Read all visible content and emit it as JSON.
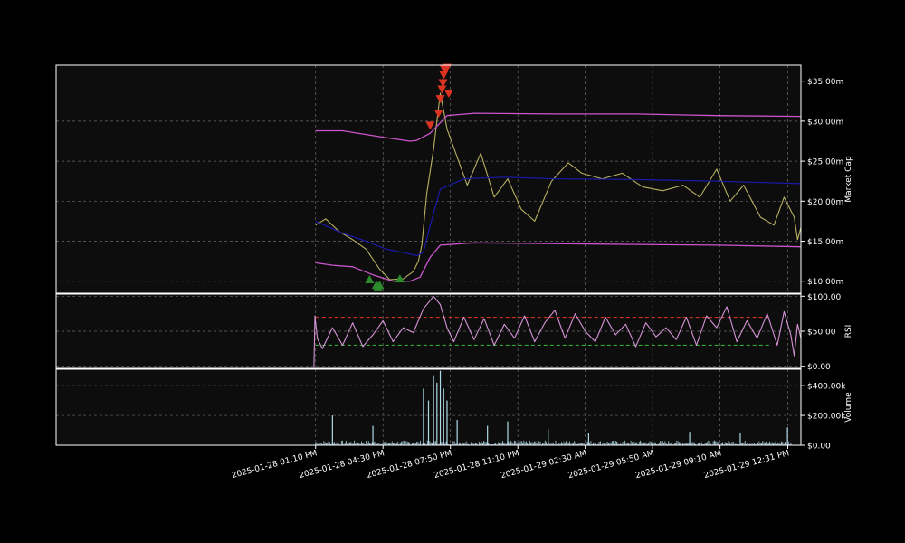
{
  "chart_data": {
    "type": "line",
    "x_range": [
      "2025-01-28 00:20",
      "2025-01-29 13:10"
    ],
    "x_ticks": [
      "2025-01-28 01:10 PM",
      "2025-01-28 04:30 PM",
      "2025-01-28 07:50 PM",
      "2025-01-28 11:10 PM",
      "2025-01-29 02:30 AM",
      "2025-01-29 05:50 AM",
      "2025-01-29 09:10 AM",
      "2025-01-29 12:31 PM"
    ],
    "x_tick_times": [
      "2025-01-28 13:10",
      "2025-01-28 16:30",
      "2025-01-28 19:50",
      "2025-01-28 23:10",
      "2025-01-29 02:30",
      "2025-01-29 05:50",
      "2025-01-29 09:10",
      "2025-01-29 12:31"
    ],
    "grid": true,
    "panels": {
      "price": {
        "ylabel": "Market Cap",
        "ylim": [
          8.5,
          37.0
        ],
        "y_ticks": [
          10,
          15,
          20,
          25,
          30,
          35
        ],
        "y_tick_labels": [
          "$10.00m",
          "$15.00m",
          "$20.00m",
          "$25.00m",
          "$30.00m",
          "$35.00m"
        ],
        "unit": "$ millions",
        "series": [
          {
            "color": "#b8b060",
            "x": [
              "2025-01-28 13:10",
              "2025-01-28 13:40",
              "2025-01-28 14:20",
              "2025-01-28 15:00",
              "2025-01-28 15:40",
              "2025-01-28 16:20",
              "2025-01-28 16:50",
              "2025-01-28 17:30",
              "2025-01-28 18:00",
              "2025-01-28 18:15",
              "2025-01-28 18:25",
              "2025-01-28 18:40",
              "2025-01-28 19:00",
              "2025-01-28 19:20",
              "2025-01-28 19:40",
              "2025-01-28 20:10",
              "2025-01-28 20:40",
              "2025-01-28 21:20",
              "2025-01-28 22:00",
              "2025-01-28 22:40",
              "2025-01-28 23:20",
              "2025-01-29 00:00",
              "2025-01-29 00:50",
              "2025-01-29 01:40",
              "2025-01-29 02:20",
              "2025-01-29 03:20",
              "2025-01-29 04:20",
              "2025-01-29 05:20",
              "2025-01-29 06:20",
              "2025-01-29 07:20",
              "2025-01-29 08:10",
              "2025-01-29 09:00",
              "2025-01-29 09:40",
              "2025-01-29 10:20",
              "2025-01-29 11:10",
              "2025-01-29 11:50",
              "2025-01-29 12:20",
              "2025-01-29 12:50",
              "2025-01-29 13:00",
              "2025-01-29 13:10"
            ],
            "y": [
              17.0,
              17.8,
              16.2,
              15.2,
              14.0,
              11.5,
              10.2,
              10.3,
              11.2,
              12.5,
              14.5,
              21.0,
              26.5,
              33.5,
              29.0,
              25.5,
              22.0,
              26.0,
              20.5,
              22.8,
              19.0,
              17.5,
              22.5,
              24.8,
              23.5,
              22.8,
              23.5,
              21.8,
              21.3,
              22.0,
              20.5,
              24.0,
              20.0,
              22.0,
              18.0,
              17.0,
              20.5,
              18.0,
              15.2,
              16.7
            ]
          },
          {
            "color": "#1a1aaa",
            "x": [
              "2025-01-28 13:10",
              "2025-01-28 14:30",
              "2025-01-28 15:40",
              "2025-01-28 16:40",
              "2025-01-28 17:40",
              "2025-01-28 18:10",
              "2025-01-28 18:30",
              "2025-01-28 18:50",
              "2025-01-28 19:20",
              "2025-01-28 20:30",
              "2025-01-28 22:30",
              "2025-01-29 01:00",
              "2025-01-29 05:00",
              "2025-01-29 09:00",
              "2025-01-29 13:10"
            ],
            "y": [
              17.5,
              16.0,
              15.0,
              14.0,
              13.5,
              13.2,
              13.6,
              17.0,
              21.5,
              22.8,
              23.0,
              22.8,
              22.7,
              22.5,
              22.2
            ]
          },
          {
            "color": "#cc55cc",
            "x": [
              "2025-01-28 13:10",
              "2025-01-28 14:30",
              "2025-01-28 16:30",
              "2025-01-28 17:50",
              "2025-01-28 18:10",
              "2025-01-28 18:50",
              "2025-01-28 19:40",
              "2025-01-28 21:00",
              "2025-01-29 01:00",
              "2025-01-29 05:00",
              "2025-01-29 09:00",
              "2025-01-29 13:10"
            ],
            "y": [
              28.8,
              28.8,
              28.0,
              27.5,
              27.6,
              28.5,
              30.7,
              31.0,
              30.9,
              30.9,
              30.7,
              30.6
            ]
          },
          {
            "color": "#cc55cc",
            "x": [
              "2025-01-28 13:10",
              "2025-01-28 14:00",
              "2025-01-28 15:00",
              "2025-01-28 16:00",
              "2025-01-28 17:00",
              "2025-01-28 17:50",
              "2025-01-28 18:20",
              "2025-01-28 18:50",
              "2025-01-28 19:20",
              "2025-01-28 21:00",
              "2025-01-29 01:00",
              "2025-01-29 05:00",
              "2025-01-29 09:00",
              "2025-01-29 13:10"
            ],
            "y": [
              12.3,
              12.0,
              11.8,
              10.8,
              10.0,
              10.0,
              10.5,
              13.0,
              14.5,
              14.8,
              14.7,
              14.6,
              14.5,
              14.3
            ]
          }
        ],
        "buy_markers": {
          "color": "#2d8a2d",
          "x": [
            "2025-01-28 15:50",
            "2025-01-28 16:10",
            "2025-01-28 16:15",
            "2025-01-28 16:20",
            "2025-01-28 17:20"
          ],
          "y": [
            10.2,
            9.5,
            9.3,
            9.5,
            10.3
          ]
        },
        "sell_markers": {
          "color": "#dd3322",
          "x": [
            "2025-01-28 18:50",
            "2025-01-28 19:15",
            "2025-01-28 19:20",
            "2025-01-28 19:25",
            "2025-01-28 19:28",
            "2025-01-28 19:30",
            "2025-01-28 19:32",
            "2025-01-28 19:40",
            "2025-01-28 19:45"
          ],
          "y": [
            29.5,
            31.0,
            32.8,
            34.0,
            34.8,
            35.8,
            36.5,
            36.7,
            33.5
          ]
        }
      },
      "rsi": {
        "ylabel": "RSI",
        "ylim": [
          -3,
          103
        ],
        "y_ticks": [
          0,
          50,
          100
        ],
        "y_tick_labels": [
          "$0.00",
          "$50.00",
          "$100.00"
        ],
        "overbought": 70,
        "oversold": 30,
        "color": "#d694d6",
        "x": [
          "2025-01-28 13:05",
          "2025-01-28 13:08",
          "2025-01-28 13:15",
          "2025-01-28 13:30",
          "2025-01-28 14:00",
          "2025-01-28 14:30",
          "2025-01-28 15:00",
          "2025-01-28 15:30",
          "2025-01-28 16:00",
          "2025-01-28 16:30",
          "2025-01-28 17:00",
          "2025-01-28 17:30",
          "2025-01-28 18:00",
          "2025-01-28 18:30",
          "2025-01-28 19:00",
          "2025-01-28 19:20",
          "2025-01-28 19:40",
          "2025-01-28 20:00",
          "2025-01-28 20:30",
          "2025-01-28 21:00",
          "2025-01-28 21:30",
          "2025-01-28 22:00",
          "2025-01-28 22:30",
          "2025-01-28 23:00",
          "2025-01-28 23:30",
          "2025-01-29 00:00",
          "2025-01-29 00:30",
          "2025-01-29 01:00",
          "2025-01-29 01:30",
          "2025-01-29 02:00",
          "2025-01-29 02:30",
          "2025-01-29 03:00",
          "2025-01-29 03:30",
          "2025-01-29 04:00",
          "2025-01-29 04:30",
          "2025-01-29 05:00",
          "2025-01-29 05:30",
          "2025-01-29 06:00",
          "2025-01-29 06:30",
          "2025-01-29 07:00",
          "2025-01-29 07:30",
          "2025-01-29 08:00",
          "2025-01-29 08:30",
          "2025-01-29 09:00",
          "2025-01-29 09:30",
          "2025-01-29 10:00",
          "2025-01-29 10:30",
          "2025-01-29 11:00",
          "2025-01-29 11:30",
          "2025-01-29 12:00",
          "2025-01-29 12:20",
          "2025-01-29 12:40",
          "2025-01-29 12:50",
          "2025-01-29 13:00",
          "2025-01-29 13:10"
        ],
        "y": [
          0,
          72,
          40,
          25,
          55,
          30,
          62,
          28,
          45,
          65,
          35,
          55,
          48,
          82,
          100,
          88,
          55,
          35,
          70,
          38,
          68,
          30,
          60,
          40,
          72,
          35,
          62,
          80,
          40,
          75,
          50,
          35,
          70,
          45,
          60,
          28,
          62,
          42,
          55,
          38,
          70,
          30,
          72,
          55,
          85,
          35,
          65,
          40,
          75,
          30,
          78,
          45,
          15,
          60,
          40
        ]
      },
      "volume": {
        "ylabel": "Volume",
        "ylim": [
          0,
          510
        ],
        "y_ticks": [
          0,
          200,
          400
        ],
        "y_tick_labels": [
          "$0.00",
          "$200.00k",
          "$400.00k"
        ],
        "unit": "thousands",
        "color": "#aed8e6",
        "spikes_x": [
          "2025-01-28 14:00",
          "2025-01-28 16:00",
          "2025-01-28 18:30",
          "2025-01-28 18:45",
          "2025-01-28 19:00",
          "2025-01-28 19:10",
          "2025-01-28 19:20",
          "2025-01-28 19:30",
          "2025-01-28 19:40",
          "2025-01-28 20:10",
          "2025-01-28 21:40",
          "2025-01-28 22:40",
          "2025-01-29 00:40",
          "2025-01-29 02:40",
          "2025-01-29 07:40",
          "2025-01-29 10:10",
          "2025-01-29 12:30"
        ],
        "spikes_y": [
          200,
          130,
          380,
          300,
          470,
          420,
          500,
          380,
          300,
          170,
          130,
          160,
          110,
          80,
          90,
          80,
          120
        ]
      }
    }
  }
}
